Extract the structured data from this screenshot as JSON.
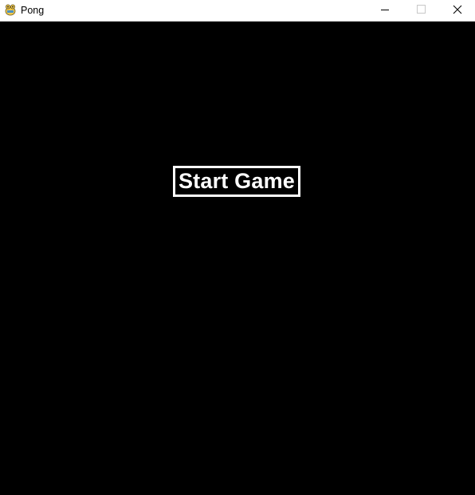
{
  "window": {
    "title": "Pong",
    "icon": "pygame-snake-icon",
    "controls": {
      "minimize_icon": "minimize-icon",
      "maximize_icon": "maximize-icon",
      "close_icon": "close-icon"
    }
  },
  "game": {
    "background_color": "#000000",
    "start_button_label": "Start Game",
    "start_button_color": "#ffffff"
  }
}
